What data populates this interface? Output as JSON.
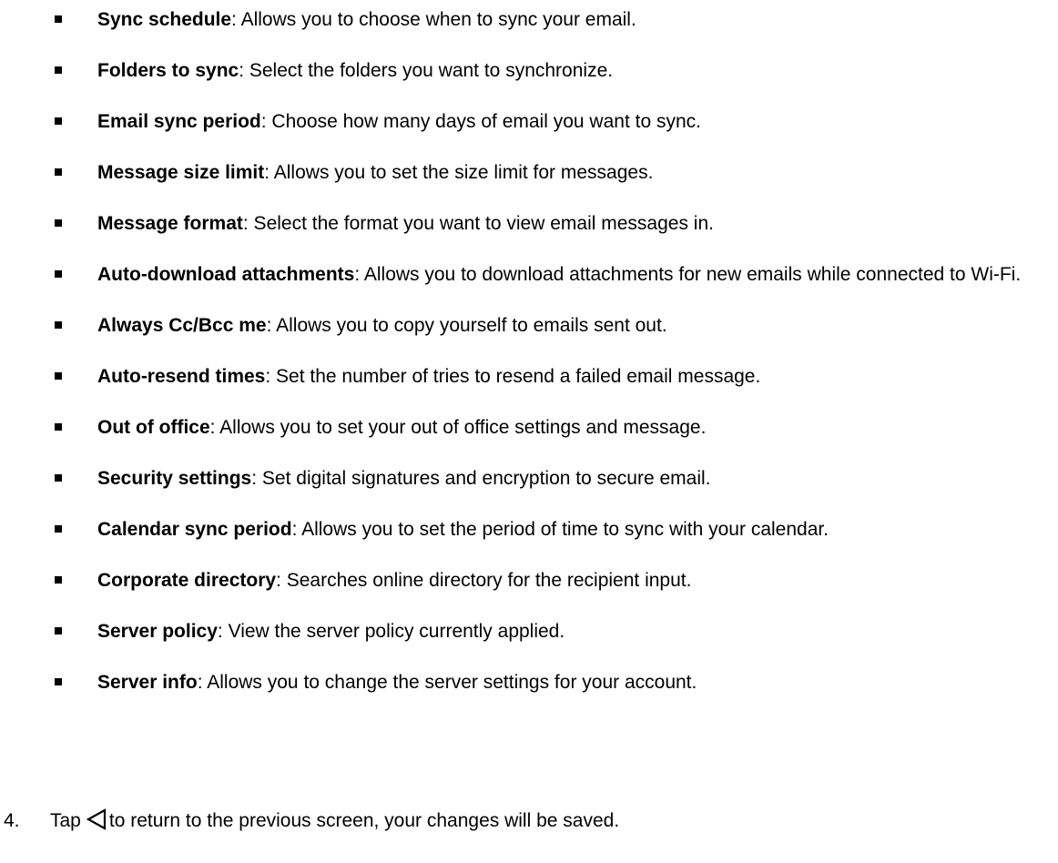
{
  "settings_list": [
    {
      "term": "Sync schedule",
      "description": ": Allows you to choose when to sync your email."
    },
    {
      "term": "Folders to sync",
      "description": ": Select the folders you want to synchronize."
    },
    {
      "term": "Email sync period",
      "description": ": Choose how many days of email you want to sync."
    },
    {
      "term": "Message size limit",
      "description": ": Allows you to set the size limit for messages."
    },
    {
      "term": "Message format",
      "description": ": Select the format you want to view email messages in."
    },
    {
      "term": "Auto-download attachments",
      "description": ": Allows you to download attachments for new emails while connected to Wi-Fi."
    },
    {
      "term": "Always Cc/Bcc me",
      "description": ": Allows you to copy yourself to emails sent out."
    },
    {
      "term": "Auto-resend times",
      "description": ": Set the number of tries to resend a failed email message."
    },
    {
      "term": "Out of office",
      "description": ": Allows you to set your out of office settings and message."
    },
    {
      "term": "Security settings",
      "description": ": Set digital signatures and encryption to secure email."
    },
    {
      "term": "Calendar sync period",
      "description": ": Allows you to set the period of time to sync with your calendar."
    },
    {
      "term": "Corporate directory",
      "description": ": Searches online directory for the recipient input."
    },
    {
      "term": "Server policy",
      "description": ": View the server policy currently applied."
    },
    {
      "term": "Server info",
      "description": ": Allows you to change the server settings for your account."
    }
  ],
  "step": {
    "number": "4.",
    "text_before": "Tap",
    "icon": "back-triangle-icon",
    "text_after": "to return to the previous screen, your changes will be saved."
  }
}
